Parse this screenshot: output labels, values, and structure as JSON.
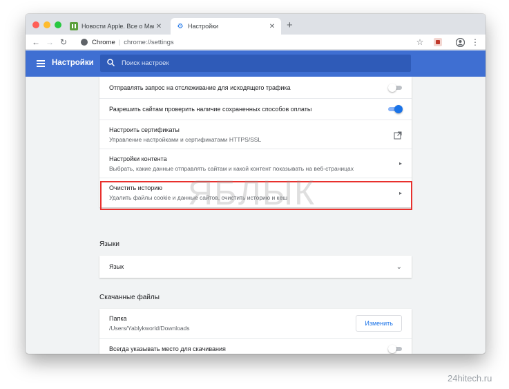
{
  "browser": {
    "tabs": [
      {
        "title": "Новости Apple. Все о Mac, iPh",
        "active": false,
        "icon": "green-site-favicon"
      },
      {
        "title": "Настройки",
        "active": true,
        "icon": "settings-gear-icon"
      }
    ],
    "address": {
      "site_label": "Chrome",
      "url": "chrome://settings"
    },
    "traffic_lights": {
      "close": "#ff5f57",
      "minimize": "#febc2e",
      "maximize": "#28c840"
    }
  },
  "appbar": {
    "title": "Настройки",
    "search_placeholder": "Поиск настроек",
    "color": "#3f6fd2"
  },
  "privacy_rows": [
    {
      "main": "Отправлять запрос на отслеживание для исходящего трафика",
      "control": "toggle",
      "on": false
    },
    {
      "main": "Разрешить сайтам проверить наличие сохраненных способов оплаты",
      "control": "toggle",
      "on": true
    },
    {
      "main": "Настроить сертификаты",
      "sub": "Управление настройками и сертификатами HTTPS/SSL",
      "control": "external-link"
    },
    {
      "main": "Настройки контента",
      "sub": "Выбрать, какие данные отправлять сайтам и какой контент показывать на веб-страницах",
      "control": "arrow"
    },
    {
      "main": "Очистить историю",
      "sub": "Удалить файлы cookie и данные сайтов, очистить историю и кеш",
      "control": "arrow",
      "highlighted": true
    }
  ],
  "languages": {
    "heading": "Языки",
    "row_label": "Язык"
  },
  "downloads": {
    "heading": "Скачанные файлы",
    "folder_label": "Папка",
    "folder_path": "/Users/Yablykworld/Downloads",
    "change_button": "Изменить",
    "ask_label": "Всегда указывать место для скачивания",
    "ask_on": false
  },
  "watermark": "ЯБЛЫК",
  "credit": "24hitech.ru",
  "colors": {
    "accent": "#1a73e8",
    "highlight_border": "#e8302d",
    "toggle_on": "#1a73e8",
    "toggle_off": "#bdc1c6"
  }
}
